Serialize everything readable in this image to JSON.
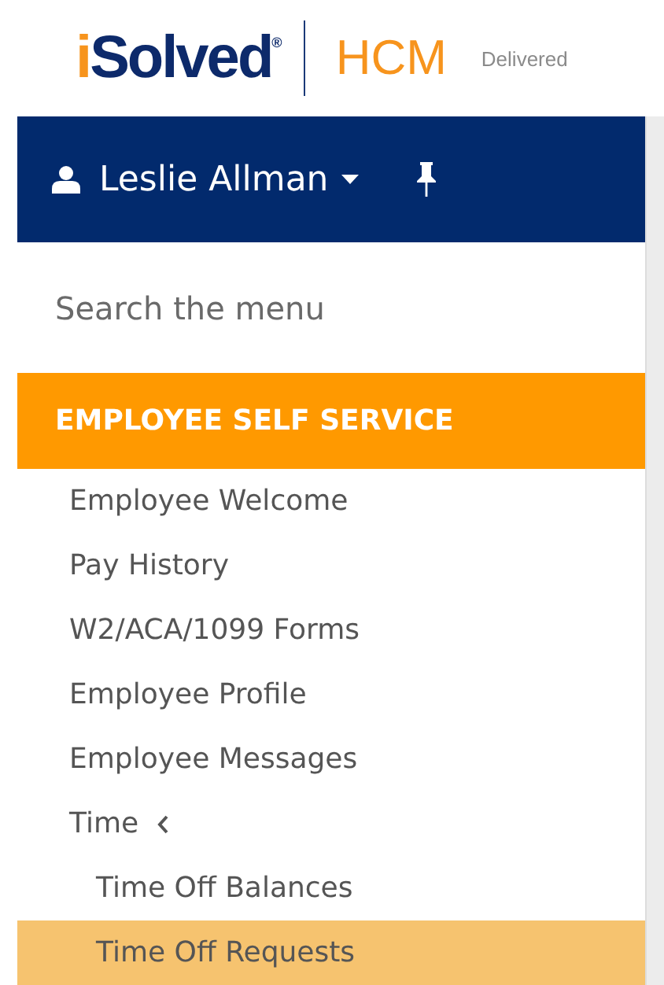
{
  "header": {
    "logo": "iSolved$^{®}$",
    "product": "HCM",
    "tagline": "Delivered"
  },
  "user_bar": {
    "name": "Leslie Allman"
  },
  "search": {
    "placeholder": "Search the menu"
  },
  "section": {
    "title": "EMPLOYEE SELF SERVICE"
  },
  "menu": [
    {
      "label": "Employee Welcome",
      "selected": false
    },
    {
      "label": "Pay History",
      "selected": false
    },
    {
      "label": "W2/ACA/1099 Forms",
      "selected": false
    },
    {
      "label": "Employee Profile",
      "selected": false
    },
    {
      "label": "Employee Messages",
      "selected": false
    },
    {
      "label": "Time",
      "selected": false,
      "expanded": true,
      "children": [
        {
          "label": "Time Off Balances",
          "selected": false
        },
        {
          "label": "Time Off Requests",
          "selected": true
        }
      ]
    }
  ]
}
